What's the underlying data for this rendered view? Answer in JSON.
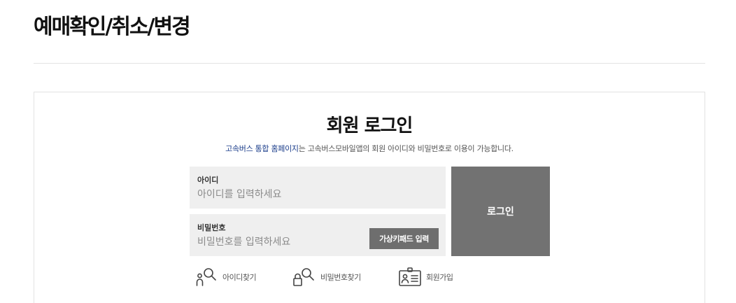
{
  "page": {
    "title": "예매확인/취소/변경"
  },
  "login": {
    "heading": "회원 로그인",
    "description_highlight": "고속버스 통합 홈페이지",
    "description_rest": "는 고속버스모바일앱의 회원 아이디와 비밀번호로 이용이 가능합니다.",
    "id_label": "아이디",
    "id_placeholder": "아이디를 입력하세요",
    "id_value": "",
    "pw_label": "비밀번호",
    "pw_placeholder": "비밀번호를 입력하세요",
    "pw_value": "",
    "virtual_keypad_label": "가상키패드 입력",
    "login_button_label": "로그인"
  },
  "links": {
    "find_id": {
      "label": "아이디찾기",
      "icon": "person-search-icon"
    },
    "find_pw": {
      "label": "비밀번호찾기",
      "icon": "lock-search-icon"
    },
    "join": {
      "label": "회원가입",
      "icon": "id-card-icon"
    }
  },
  "colors": {
    "highlight_text": "#1a3c8a",
    "button_gray": "#727272",
    "field_bg": "#efefef"
  }
}
